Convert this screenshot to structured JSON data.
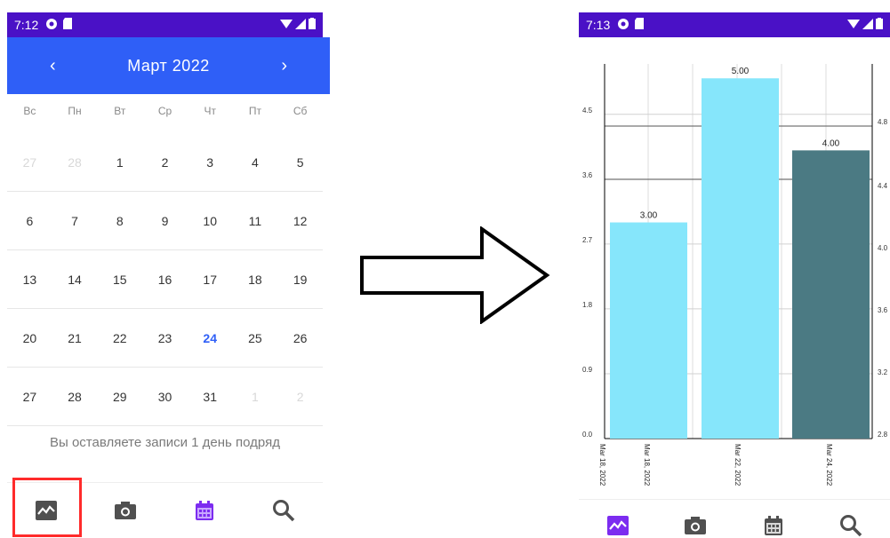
{
  "left_phone": {
    "status": {
      "time": "7:12"
    },
    "calendar": {
      "month_title": "Март 2022",
      "prev": "‹",
      "next": "›",
      "weekdays": [
        "Вс",
        "Пн",
        "Вт",
        "Ср",
        "Чт",
        "Пт",
        "Сб"
      ],
      "weeks": [
        [
          "27",
          "28",
          "1",
          "2",
          "3",
          "4",
          "5"
        ],
        [
          "6",
          "7",
          "8",
          "9",
          "10",
          "11",
          "12"
        ],
        [
          "13",
          "14",
          "15",
          "16",
          "17",
          "18",
          "19"
        ],
        [
          "20",
          "21",
          "22",
          "23",
          "24",
          "25",
          "26"
        ],
        [
          "27",
          "28",
          "29",
          "30",
          "31",
          "1",
          "2"
        ]
      ],
      "today": "24",
      "caption": "Вы оставляете записи 1 день подряд"
    },
    "nav_items": [
      "chart-icon",
      "camera-icon",
      "calendar-icon",
      "search-icon"
    ],
    "active_nav": "calendar-icon"
  },
  "right_phone": {
    "status": {
      "time": "7:13"
    },
    "nav_items": [
      "chart-icon",
      "camera-icon",
      "calendar-icon",
      "search-icon"
    ],
    "active_nav": "chart-icon"
  },
  "colors": {
    "status_bar": "#4a11c6",
    "calendar_header": "#2f5ff7",
    "accent": "#7c2cf0",
    "bar_light": "#86e6fb",
    "bar_dark": "#4b7a83",
    "highlight": "#ff2b2b"
  },
  "chart_data": {
    "type": "bar",
    "categories": [
      "Mar 18, 2022",
      "Mar 22, 2022",
      "Mar 24, 2022"
    ],
    "values": [
      3.0,
      5.0,
      4.0
    ],
    "data_labels": [
      "3.00",
      "5.00",
      "4.00"
    ],
    "left_axis_ticks": [
      "0.0",
      "0.9",
      "1.8",
      "2.7",
      "3.6",
      "4.5"
    ],
    "right_axis_ticks": [
      "2.8",
      "3.2",
      "3.6",
      "4.0",
      "4.4",
      "4.8"
    ],
    "extra_x_label": "Mar 18, 2022",
    "grid": true
  }
}
